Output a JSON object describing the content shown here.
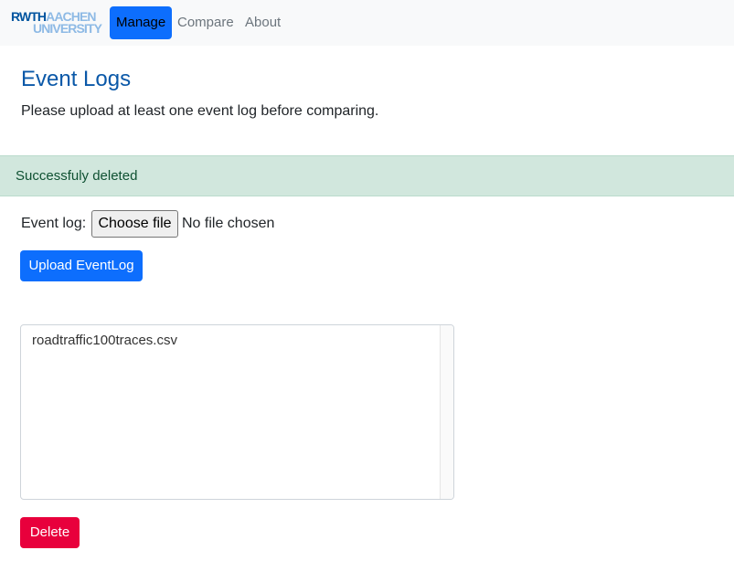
{
  "navbar": {
    "logo": {
      "line1_bold": "RWTH",
      "line1_light": "AACHEN",
      "line2": "UNIVERSITY"
    },
    "links": [
      {
        "label": "Manage",
        "active": true
      },
      {
        "label": "Compare",
        "active": false
      },
      {
        "label": "About",
        "active": false
      }
    ]
  },
  "main": {
    "title": "Event Logs",
    "subtitle": "Please upload at least one event log before comparing."
  },
  "alert": {
    "message": "Successfuly deleted"
  },
  "upload": {
    "label": "Event log:",
    "choose_button": "Choose file",
    "status": "No file chosen",
    "submit_label": "Upload EventLog"
  },
  "event_logs": {
    "items": [
      "roadtraffic100traces.csv"
    ]
  },
  "delete_label": "Delete",
  "colors": {
    "primary": "#0d6efd",
    "danger": "#e8003c",
    "success_bg": "#d1e7dd",
    "title": "#0a58a8"
  }
}
